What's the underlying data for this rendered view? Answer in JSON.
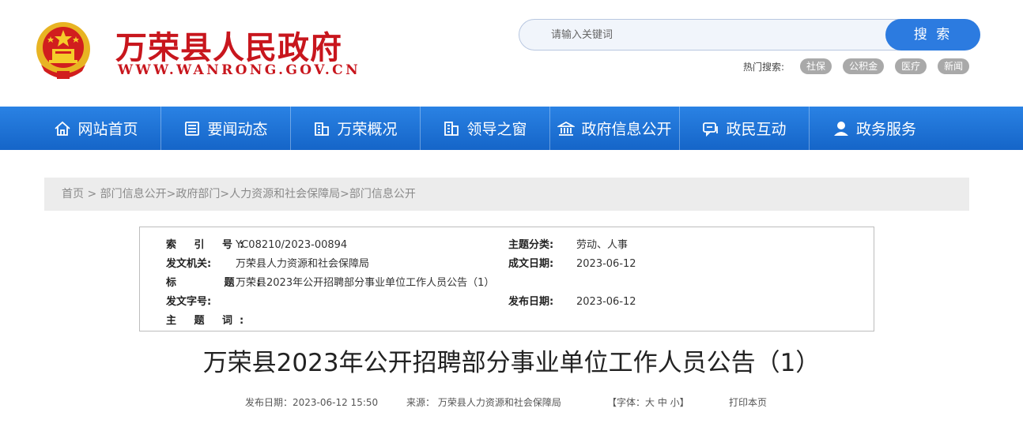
{
  "header": {
    "site_title": "万荣县人民政府",
    "site_domain": "WWW.WANRONG.GOV.CN",
    "search_placeholder": "请输入关键词",
    "search_button": "搜 索",
    "hot_label": "热门搜索:",
    "hot_tags": [
      "社保",
      "公积金",
      "医疗",
      "新闻"
    ]
  },
  "nav": {
    "items": [
      {
        "label": "网站首页",
        "icon": "home-icon"
      },
      {
        "label": "要闻动态",
        "icon": "news-icon"
      },
      {
        "label": "万荣概况",
        "icon": "building-icon"
      },
      {
        "label": "领导之窗",
        "icon": "leader-icon"
      },
      {
        "label": "政府信息公开",
        "icon": "government-icon"
      },
      {
        "label": "政民互动",
        "icon": "chat-icon"
      },
      {
        "label": "政务服务",
        "icon": "service-icon"
      }
    ],
    "color": "#1f74d8"
  },
  "breadcrumb": "首页 > 部门信息公开>政府部门>人力资源和社会保障局>部门信息公开",
  "meta": {
    "index_label": "索 引 号:",
    "index_value": "YC08210/2023-00894",
    "topic_label": "主题分类:",
    "topic_value": "劳动、人事",
    "issuer_label": "发文机关:",
    "issuer_value": "万荣县人力资源和社会保障局",
    "created_label": "成文日期:",
    "created_value": "2023-06-12",
    "title_label": "标 题:",
    "title_value": "万荣县2023年公开招聘部分事业单位工作人员公告（1）",
    "docno_label": "发文字号:",
    "docno_value": "",
    "published_label": "发布日期:",
    "published_value": "2023-06-12",
    "keywords_label": "主 题 词:",
    "keywords_value": ""
  },
  "article": {
    "title": "万荣县2023年公开招聘部分事业单位工作人员公告（1）",
    "publish_date": "发布日期：2023-06-12 15:50",
    "source": "来源：  万荣县人力资源和社会保障局",
    "font_size": "【字体：大 中 小】",
    "print": "打印本页"
  },
  "colors": {
    "brand_red": "#c8161d",
    "accent_blue": "#2c7be0"
  }
}
